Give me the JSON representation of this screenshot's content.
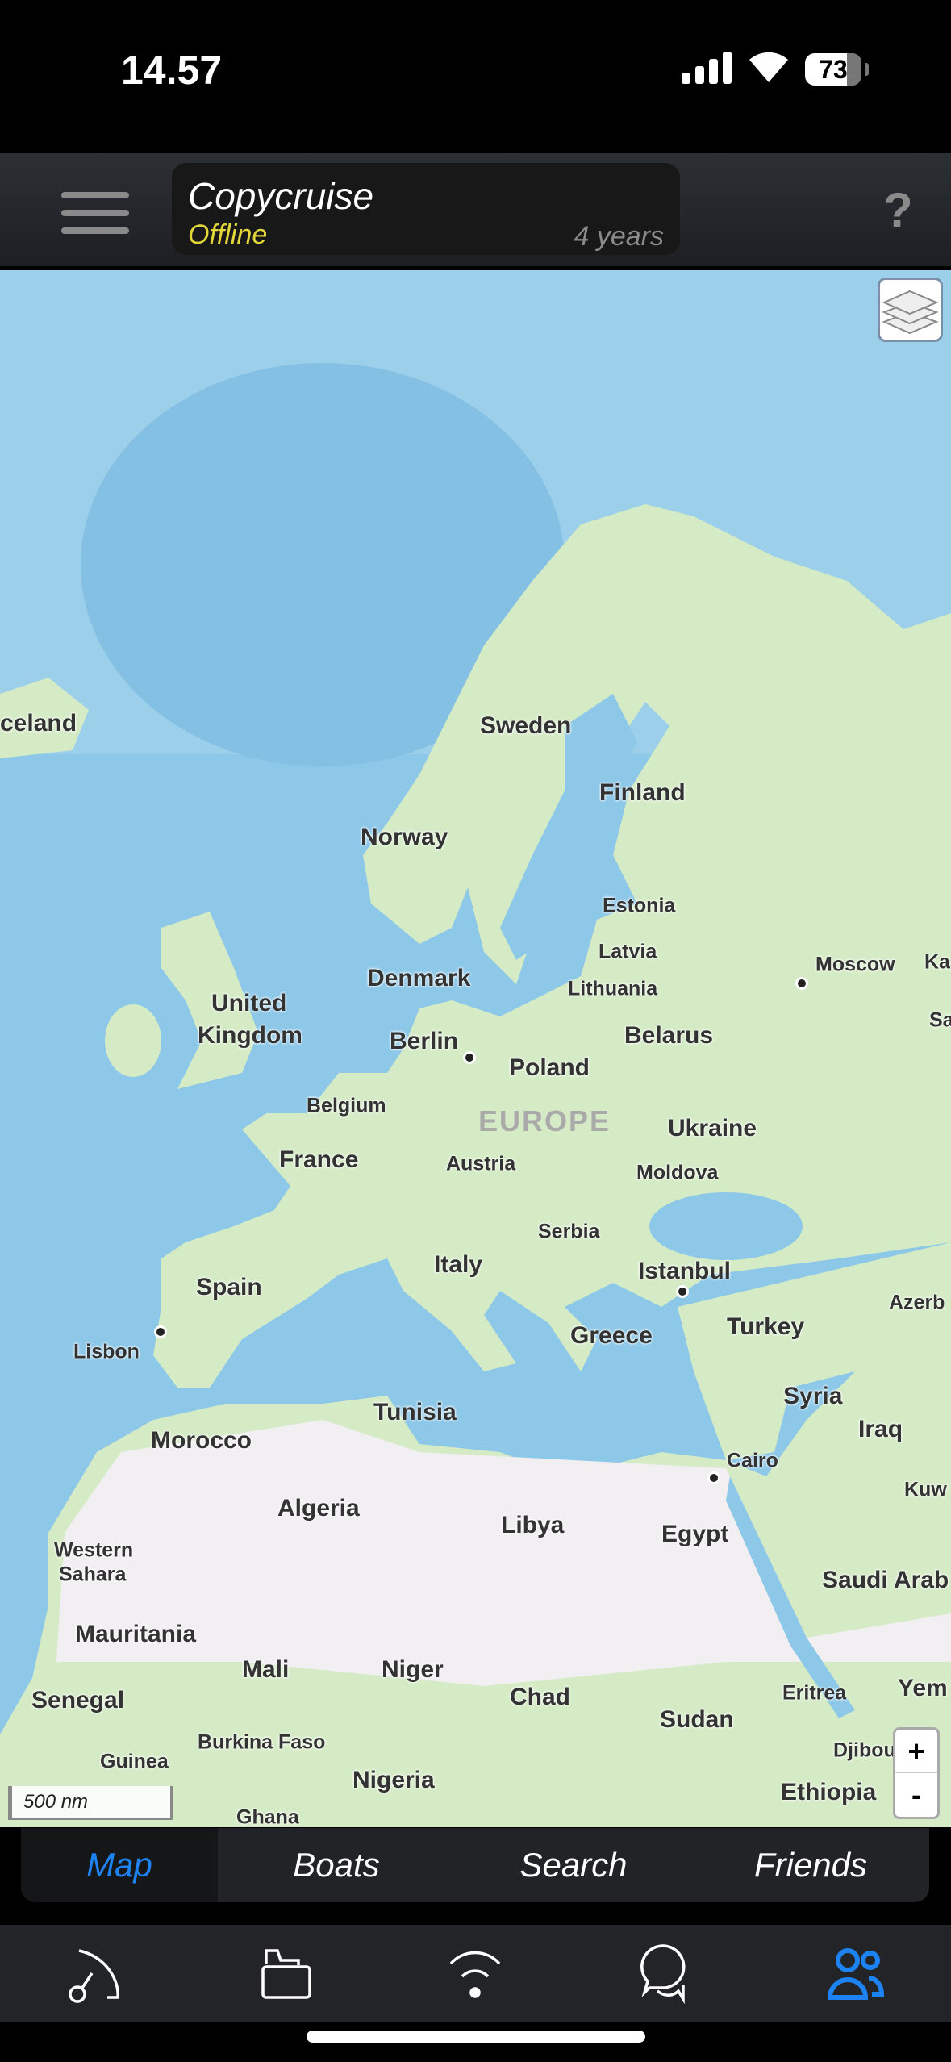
{
  "status_bar": {
    "time": "14.57",
    "battery": "73"
  },
  "header": {
    "boat_name": "Copycruise",
    "status": "Offline",
    "age": "4 years",
    "help": "?"
  },
  "map": {
    "scale": "500 nm",
    "zoom_in": "+",
    "zoom_out": "-",
    "colors": {
      "ocean": "#8ec8e8",
      "land": "#d5ebc6",
      "desert": "#f2eff2"
    },
    "labels": [
      "celand",
      "Sweden",
      "Finland",
      "Norway",
      "Estonia",
      "Latvia",
      "Lithuania",
      "Moscow",
      "Ka",
      "Sa",
      "Denmark",
      "United",
      "Kingdom",
      "Berlin",
      "Belarus",
      "Poland",
      "Belgium",
      "EUROPE",
      "Ukraine",
      "France",
      "Austria",
      "Moldova",
      "Serbia",
      "Italy",
      "Istanbul",
      "Azerb",
      "Spain",
      "Turkey",
      "Lisbon",
      "Greece",
      "Syria",
      "Tunisia",
      "Iraq",
      "Morocco",
      "Cairo",
      "Kuw",
      "Algeria",
      "Libya",
      "Egypt",
      "Western",
      "Sahara",
      "Saudi Arab",
      "Mauritania",
      "Mali",
      "Niger",
      "Senegal",
      "Chad",
      "Eritrea",
      "Yem",
      "Sudan",
      "Burkina Faso",
      "Guinea",
      "Djibou",
      "Nigeria",
      "Ethiopia",
      "Ghana"
    ]
  },
  "tabs": [
    {
      "label": "Map",
      "active": true
    },
    {
      "label": "Boats"
    },
    {
      "label": "Search"
    },
    {
      "label": "Friends"
    }
  ],
  "bottom_nav": [
    "route-icon",
    "folder-icon",
    "signal-icon",
    "chat-icon",
    "friends-icon"
  ],
  "accent": "#1e83f2"
}
